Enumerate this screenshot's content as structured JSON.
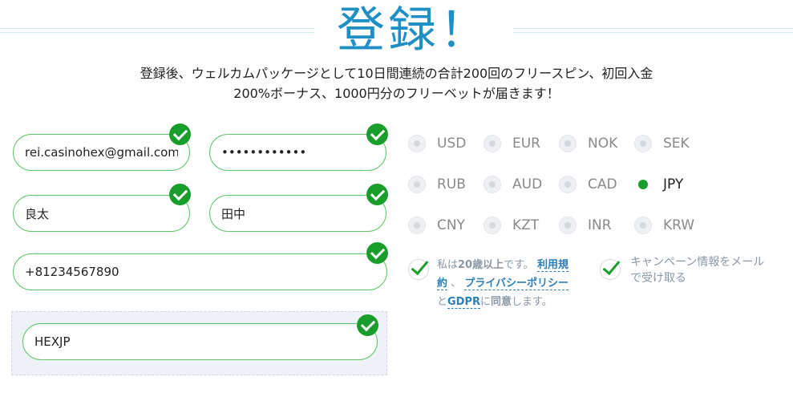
{
  "header": {
    "title": "登録！",
    "subtitle_line1": "登録後、ウェルカムパッケージとして10日間連続の合計200回のフリースピン、初回入金",
    "subtitle_line2": "200%ボーナス、1000円分のフリーベットが届きます！"
  },
  "form": {
    "email": "rei.casinohex@gmail.com",
    "password": "••••••••••••",
    "first_name": "良太",
    "last_name": "田中",
    "phone": "+81234567890",
    "promo_code": "HEXJP"
  },
  "currencies": {
    "row1": [
      "USD",
      "EUR",
      "NOK",
      "SEK"
    ],
    "row2": [
      "RUB",
      "AUD",
      "CAD",
      "JPY"
    ],
    "row3": [
      "CNY",
      "KZT",
      "INR",
      "KRW"
    ],
    "selected": "JPY"
  },
  "terms": {
    "p1": "私は",
    "p2": "20歳以上",
    "p3": "です。",
    "link1a": "利用規",
    "link1b": "約",
    "sep": "、",
    "link2": "プライバシーポリシー",
    "p4": "と",
    "link3": "GDPR",
    "p5": "に",
    "p6": "同意",
    "p7": "します。"
  },
  "marketing": {
    "line1": "キャンペーン情報をメール",
    "line2": "で受け取る"
  },
  "colors": {
    "accent": "#1f8fc6",
    "success": "#1a9e2b",
    "link": "#2b7fb8"
  }
}
